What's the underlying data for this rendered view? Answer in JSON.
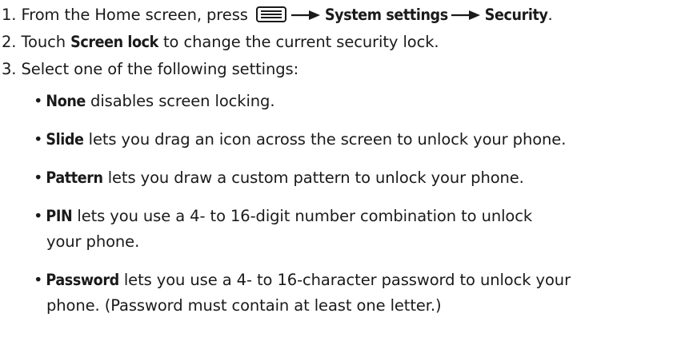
{
  "steps": [
    {
      "number": "1.",
      "text_before": "From the Home screen, press",
      "icon": "menu-icon",
      "path": [
        "System settings",
        "Security"
      ],
      "end": "."
    },
    {
      "number": "2.",
      "text_before": "Touch",
      "bold": "Screen lock",
      "text_after": "to change the current security lock."
    },
    {
      "number": "3.",
      "text": "Select one of the following settings:"
    }
  ],
  "options": [
    {
      "name": "None",
      "description": "disables screen locking."
    },
    {
      "name": "Slide",
      "description": "lets you drag an icon across the screen to unlock your phone."
    },
    {
      "name": "Pattern",
      "description": "lets you draw a custom pattern to unlock your phone."
    },
    {
      "name": "PIN",
      "description": "lets you use a 4- to 16-digit number combination to unlock",
      "continuation": "your phone."
    },
    {
      "name": "Password",
      "description": "lets you use a 4- to 16-character password to unlock your",
      "continuation": "phone. (Password must contain at least one letter.)"
    }
  ],
  "bullet_glyph": "•"
}
